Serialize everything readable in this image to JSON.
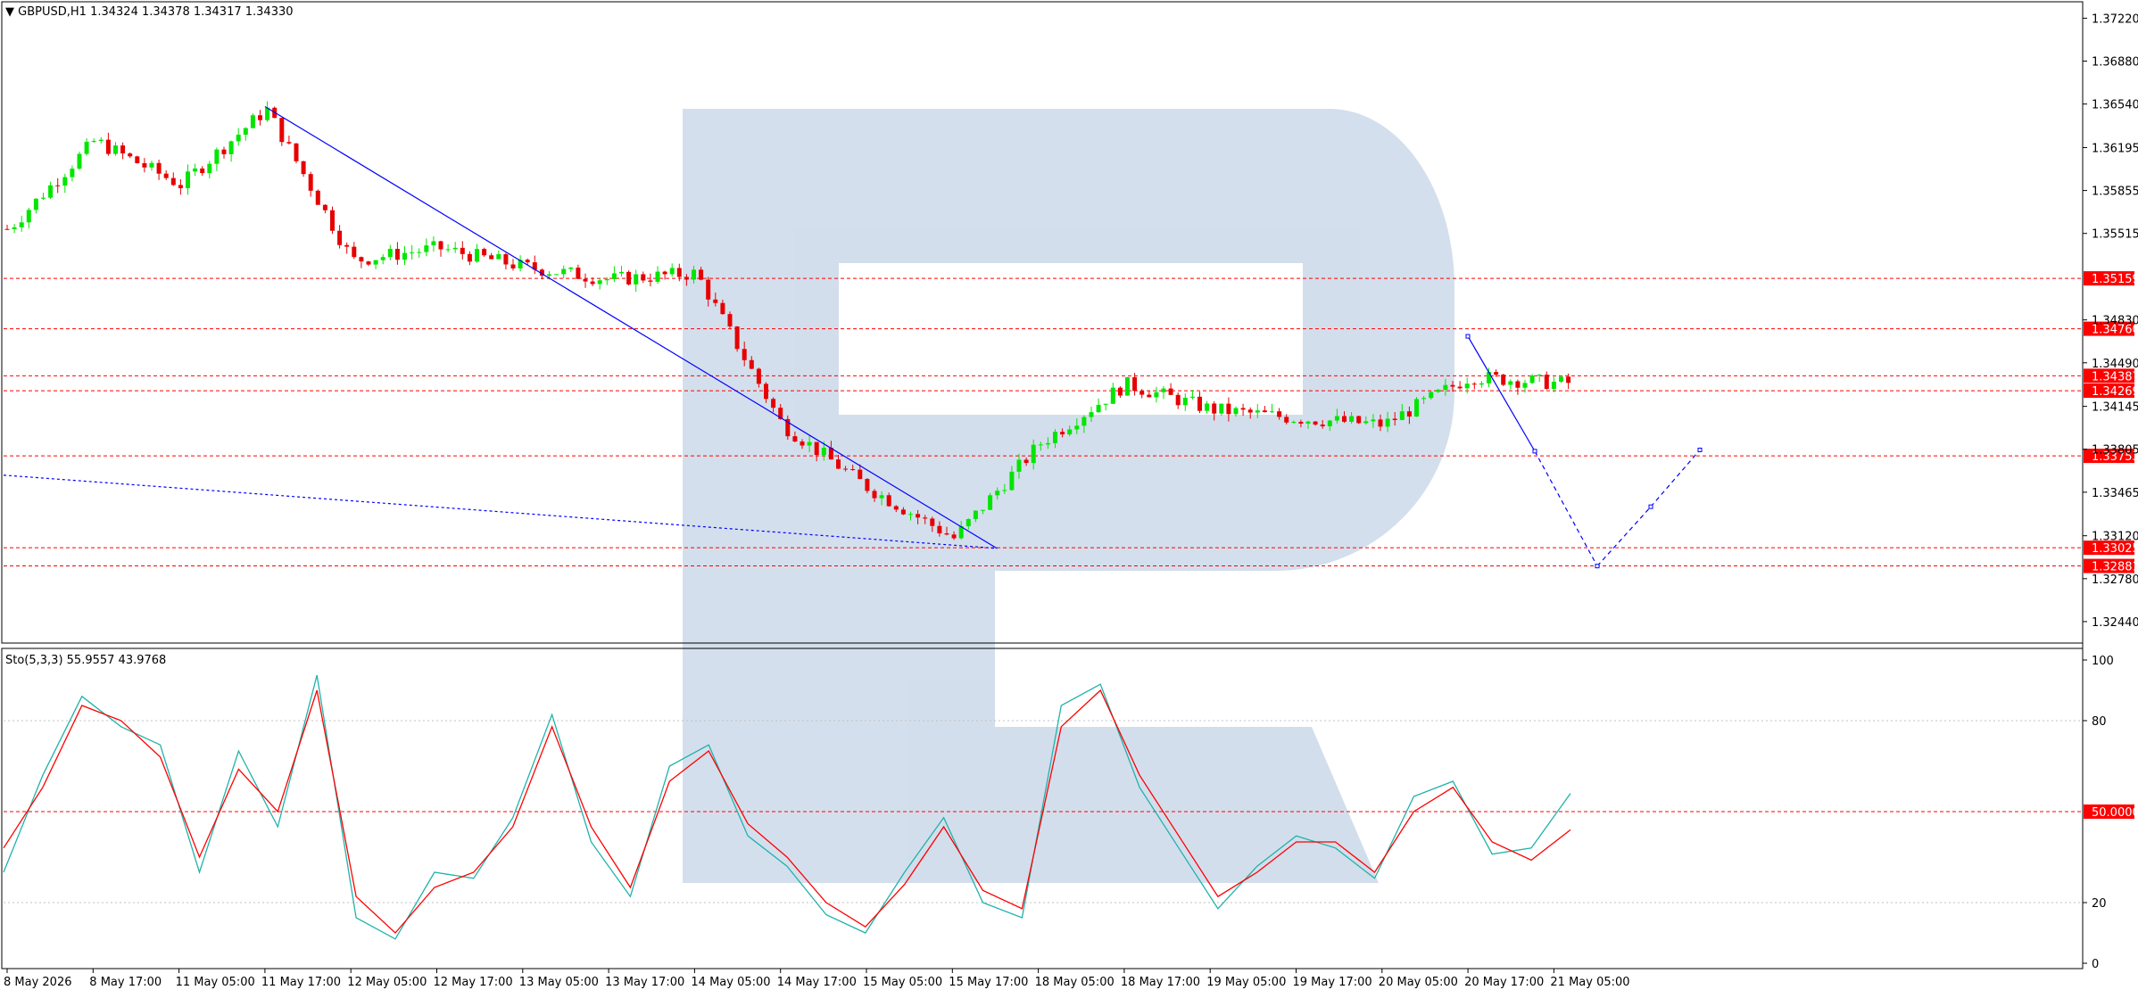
{
  "header": {
    "symbol": "GBPUSD,H1",
    "ohlc": "1.34324 1.34378 1.34317 1.34330"
  },
  "stoch_header": {
    "label": "Sto(5,3,3) 55.9557 43.9768"
  },
  "colors": {
    "bull": "#00e600",
    "bear": "#e60000",
    "trend": "#0000ff",
    "level": "#ff0000",
    "stoch_main": "#20b2aa",
    "stoch_signal": "#ff0000",
    "watermark": "#b0c4de"
  },
  "chart_data": [
    {
      "type": "candlestick",
      "title": "GBPUSD,H1",
      "ylim": [
        1.3227,
        1.3735
      ],
      "y_ticks": [
        "1.37220",
        "1.36880",
        "1.36540",
        "1.36195",
        "1.35855",
        "1.35515",
        "1.34830",
        "1.34490",
        "1.34145",
        "1.33805",
        "1.33465",
        "1.33120",
        "1.32780",
        "1.32440"
      ],
      "x_ticks": [
        "8 May 2026",
        "8 May 17:00",
        "11 May 05:00",
        "11 May 17:00",
        "12 May 05:00",
        "12 May 17:00",
        "13 May 05:00",
        "13 May 17:00",
        "14 May 05:00",
        "14 May 17:00",
        "15 May 05:00",
        "15 May 17:00",
        "18 May 05:00",
        "18 May 17:00",
        "19 May 05:00",
        "19 May 17:00",
        "20 May 05:00",
        "20 May 17:00",
        "21 May 05:00"
      ],
      "levels": [
        {
          "value": 1.35159,
          "label": "1.35159",
          "style": "dashed"
        },
        {
          "value": 1.3476,
          "label": "1.34760",
          "style": "dashed"
        },
        {
          "value": 1.34387,
          "label": "1.34387",
          "style": "dashed"
        },
        {
          "value": 1.34269,
          "label": "1.34269",
          "style": "dashed"
        },
        {
          "value": 1.33753,
          "label": "1.33753",
          "style": "dashed"
        },
        {
          "value": 1.33025,
          "label": "1.33025",
          "style": "dashed"
        },
        {
          "value": 1.32881,
          "label": "1.32881",
          "style": "dashed"
        }
      ],
      "key_prices": [
        {
          "t": "8 May 2026",
          "price": 1.3555
        },
        {
          "t": "8 May 17:00",
          "price": 1.3625
        },
        {
          "t": "11 May 05:00",
          "price": 1.359
        },
        {
          "t": "11 May 17:00",
          "price": 1.365
        },
        {
          "t": "12 May 05:00",
          "price": 1.353
        },
        {
          "t": "12 May 17:00",
          "price": 1.354
        },
        {
          "t": "13 May 05:00",
          "price": 1.3525
        },
        {
          "t": "13 May 17:00",
          "price": 1.3515
        },
        {
          "t": "14 May 05:00",
          "price": 1.352
        },
        {
          "t": "14 May 17:00",
          "price": 1.34
        },
        {
          "t": "15 May 05:00",
          "price": 1.335
        },
        {
          "t": "15 May 17:00",
          "price": 1.331
        },
        {
          "t": "18 May 05:00",
          "price": 1.3385
        },
        {
          "t": "18 May 17:00",
          "price": 1.3432
        },
        {
          "t": "19 May 05:00",
          "price": 1.3412
        },
        {
          "t": "19 May 17:00",
          "price": 1.3405
        },
        {
          "t": "20 May 05:00",
          "price": 1.34
        },
        {
          "t": "20 May 17:00",
          "price": 1.3438
        },
        {
          "t": "21 May 05:00",
          "price": 1.3433
        }
      ],
      "trend_lines": [
        {
          "from": {
            "t": "11 May 17:00",
            "price": 1.3652
          },
          "to": {
            "t": "15 May 17:00",
            "price": 1.3302
          },
          "style": "solid"
        },
        {
          "from": {
            "t": "8 May 2026",
            "price": 1.336
          },
          "to": {
            "t": "15 May 17:00",
            "price": 1.3302
          },
          "style": "dotted"
        }
      ],
      "forecast_path": [
        {
          "price": 1.347,
          "style": "solid"
        },
        {
          "price": 1.3379,
          "style": "solid"
        },
        {
          "price": 1.3288,
          "style": "dashed"
        },
        {
          "price": 1.3335,
          "style": "dashed"
        },
        {
          "price": 1.338,
          "style": "dashed"
        }
      ]
    },
    {
      "type": "line",
      "title": "Sto(5,3,3) 55.9557 43.9768",
      "ylim": [
        0,
        100
      ],
      "y_ticks": [
        "100",
        "80",
        "20",
        "0"
      ],
      "levels": [
        {
          "value": 80,
          "label": "",
          "style": "dotted"
        },
        {
          "value": 50,
          "label": "50.0000",
          "style": "dashed"
        },
        {
          "value": 20,
          "label": "",
          "style": "dotted"
        }
      ],
      "series": [
        {
          "name": "%K",
          "values": [
            30,
            62,
            88,
            78,
            72,
            30,
            70,
            45,
            95,
            15,
            8,
            30,
            28,
            48,
            82,
            40,
            22,
            65,
            72,
            42,
            32,
            16,
            10,
            30,
            48,
            20,
            15,
            85,
            92,
            58,
            38,
            18,
            32,
            42,
            38,
            28,
            55,
            60,
            36,
            38,
            56
          ]
        },
        {
          "name": "signal",
          "values": [
            38,
            58,
            85,
            80,
            68,
            35,
            64,
            50,
            90,
            22,
            10,
            25,
            30,
            45,
            78,
            45,
            25,
            60,
            70,
            46,
            35,
            20,
            12,
            26,
            45,
            24,
            18,
            78,
            90,
            62,
            42,
            22,
            30,
            40,
            40,
            30,
            50,
            58,
            40,
            34,
            44
          ]
        }
      ]
    }
  ]
}
